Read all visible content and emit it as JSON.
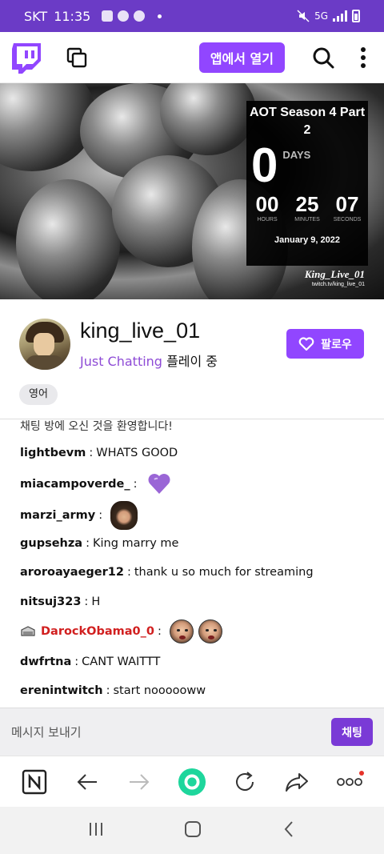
{
  "status_bar": {
    "carrier": "SKT",
    "time": "11:35",
    "network": "5G"
  },
  "top_nav": {
    "open_app_label": "앱에서 열기"
  },
  "stream": {
    "countdown_title": "AOT Season 4 Part 2",
    "days_value": "0",
    "days_label": "DAYS",
    "hours_value": "00",
    "hours_label": "HOURS",
    "minutes_value": "25",
    "minutes_label": "MINUTES",
    "seconds_value": "07",
    "seconds_label": "SECONDS",
    "date": "January 9, 2022",
    "watermark_name": "King_Live_01",
    "watermark_url": "twitch.tv/king_live_01"
  },
  "channel": {
    "name": "king_live_01",
    "game": "Just Chatting",
    "playing_suffix": "플레이 중",
    "follow_label": "팔로우",
    "tag": "영어"
  },
  "chat": {
    "welcome": "채팅 방에 오신 것을 환영합니다!",
    "messages": [
      {
        "user": "lightbevm",
        "text": "WHATS GOOD"
      },
      {
        "user": "miacampoverde_",
        "text": ""
      },
      {
        "user": "marzi_army",
        "text": ""
      },
      {
        "user": "gupsehza",
        "text": "King marry me"
      },
      {
        "user": "aroroayaeger12",
        "text": "thank u so much for streaming"
      },
      {
        "user": "nitsuj323",
        "text": "H"
      },
      {
        "user": "DarockObama0_0",
        "text": ""
      },
      {
        "user": "dwfrtna",
        "text": "CANT WAITTT"
      },
      {
        "user": "erenintwitch",
        "text": "start noooooww"
      }
    ],
    "separator": ":",
    "input_placeholder": "메시지 보내기",
    "send_label": "채팅"
  },
  "colors": {
    "accent": "#9146ff",
    "status_bar": "#6b3bc6",
    "highlight_user": "#d11f1f"
  }
}
